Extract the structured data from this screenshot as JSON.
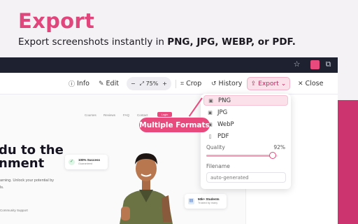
{
  "hero": {
    "title": "Export",
    "subtitle_prefix": "Export screenshots instantly in ",
    "subtitle_formats": "PNG, JPG, WEBP, or PDF."
  },
  "toolbar": {
    "info_label": "Info",
    "edit_label": "Edit",
    "zoom_minus": "−",
    "zoom_value": "75%",
    "zoom_plus": "+",
    "crop_label": "Crop",
    "history_label": "History",
    "export_label": "Export",
    "close_label": "Close"
  },
  "export_menu": {
    "formats": [
      {
        "label": "PNG",
        "icon": "image-icon"
      },
      {
        "label": "JPG",
        "icon": "image-icon"
      },
      {
        "label": "WebP",
        "icon": "image-icon"
      },
      {
        "label": "PDF",
        "icon": "document-icon"
      }
    ],
    "quality_label": "Quality",
    "quality_value": "92%",
    "quality_level": 0.92,
    "filename_label": "Filename",
    "filename_placeholder": "auto-generated"
  },
  "callout": {
    "label": "Multiple Formats"
  },
  "webpage": {
    "nav": [
      "Courses",
      "Reviews",
      "FAQ",
      "Contact"
    ],
    "nav_cta": "Login",
    "headline_line1": "du to the",
    "headline_line2": "nment",
    "subtext_line1": "arning. Unlock your potential by",
    "subtext_line2": "ls.",
    "support": "Community Support",
    "card1_title": "100% Success",
    "card1_sub": "Guaranteed",
    "card2_title": "50k+ Students",
    "card2_sub": "Trusted by many"
  },
  "colors": {
    "accent": "#e0457b",
    "accent_dark": "#cc3470",
    "chrome": "#1e2230"
  }
}
